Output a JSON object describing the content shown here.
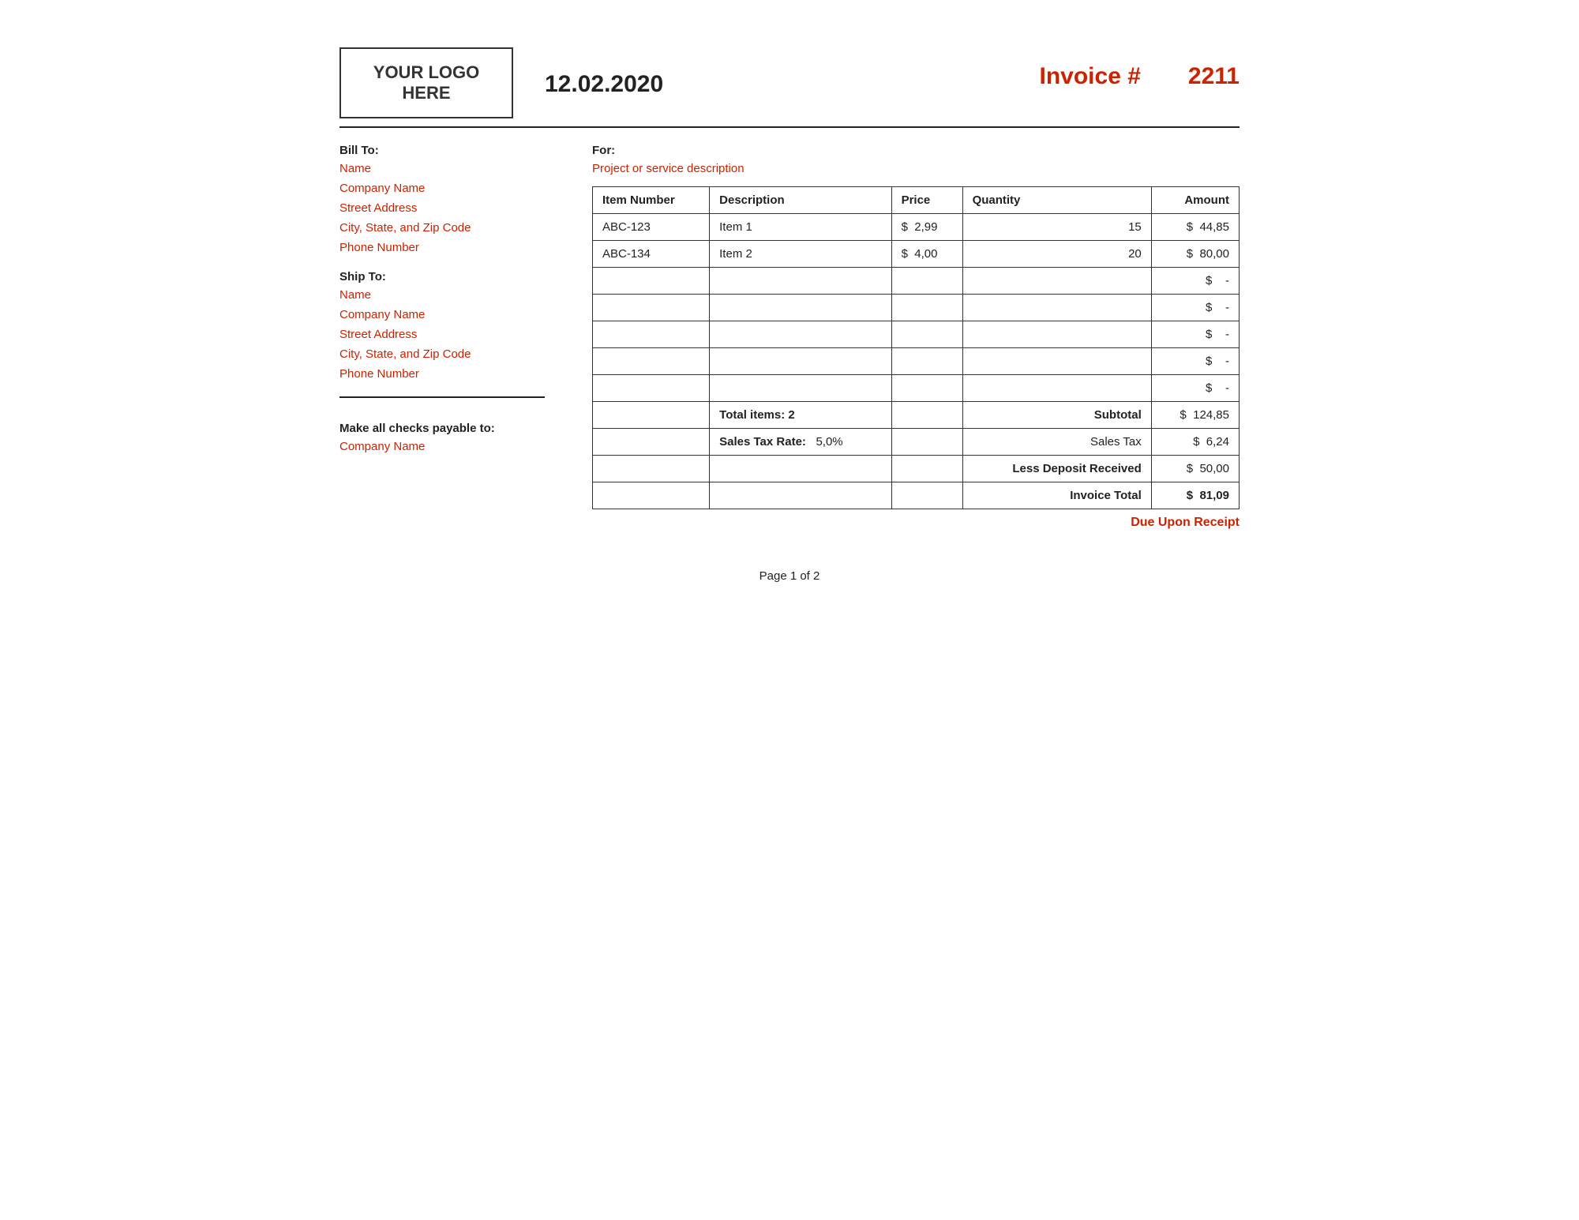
{
  "header": {
    "logo_text": "YOUR LOGO\nHERE",
    "date": "12.02.2020",
    "invoice_label": "Invoice #",
    "invoice_number": "2211"
  },
  "bill_to": {
    "label": "Bill To:",
    "name": "Name",
    "company": "Company Name",
    "street": "Street Address",
    "city": "City, State, and Zip Code",
    "phone": "Phone Number"
  },
  "ship_to": {
    "label": "Ship To:",
    "name": "Name",
    "company": "Company Name",
    "street": "Street Address",
    "city": "City, State, and Zip Code",
    "phone": "Phone Number"
  },
  "for": {
    "label": "For:",
    "description": "Project or service description"
  },
  "table": {
    "headers": [
      "Item Number",
      "Description",
      "Price",
      "Quantity",
      "Amount"
    ],
    "rows": [
      {
        "item_number": "ABC-123",
        "description": "Item 1",
        "price": "2,99",
        "quantity": "15",
        "amount": "44,85"
      },
      {
        "item_number": "ABC-134",
        "description": "Item 2",
        "price": "4,00",
        "quantity": "20",
        "amount": "80,00"
      },
      {
        "item_number": "",
        "description": "",
        "price": "",
        "quantity": "",
        "amount": "-"
      },
      {
        "item_number": "",
        "description": "",
        "price": "",
        "quantity": "",
        "amount": "-"
      },
      {
        "item_number": "",
        "description": "",
        "price": "",
        "quantity": "",
        "amount": "-"
      },
      {
        "item_number": "",
        "description": "",
        "price": "",
        "quantity": "",
        "amount": "-"
      },
      {
        "item_number": "",
        "description": "",
        "price": "",
        "quantity": "",
        "amount": "-"
      }
    ],
    "total_items_label": "Total items: 2",
    "subtotal_label": "Subtotal",
    "subtotal_value": "124,85",
    "sales_tax_rate_label": "Sales Tax Rate:",
    "sales_tax_rate_value": "5,0%",
    "sales_tax_label": "Sales Tax",
    "sales_tax_value": "6,24",
    "less_deposit_label": "Less Deposit Received",
    "less_deposit_value": "50,00",
    "invoice_total_label": "Invoice Total",
    "invoice_total_value": "81,09"
  },
  "checks": {
    "label": "Make all checks payable to:",
    "company": "Company Name"
  },
  "due": {
    "label": "Due Upon Receipt"
  },
  "footer": {
    "page": "Page 1 of 2"
  }
}
